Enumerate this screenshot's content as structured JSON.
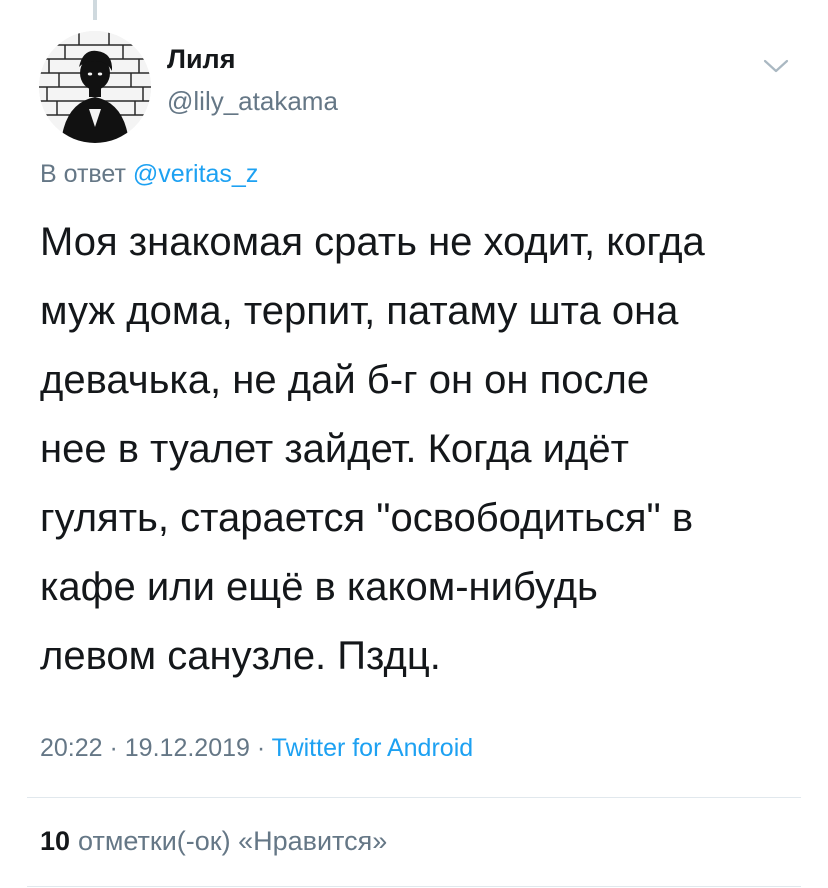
{
  "tweet": {
    "author": {
      "name": "Лиля",
      "handle": "@lily_atakama"
    },
    "reply": {
      "prefix": "В ответ",
      "mention": "@veritas_z"
    },
    "text": "Моя знакомая срать не ходит, когда\nмуж дома, терпит, патаму шта она\nдевачька, не дай б-г он он после\nнее в туалет зайдет. Когда идёт\nгулять, старается \"освободиться\" в\nкафе или ещё в каком-нибудь\nлевом санузле. Пздц.",
    "meta": {
      "time": "20:22",
      "separator": " · ",
      "date": "19.12.2019",
      "source": "Twitter for Android"
    },
    "likes": {
      "count": "10",
      "label": "отметки(-ок) «Нравится»"
    }
  },
  "icons": {
    "more": "chevron-down-icon",
    "avatar": "profile-photo"
  },
  "colors": {
    "text": "#14171a",
    "secondary": "#657786",
    "link": "#1da1f2",
    "divider": "#e1e8ed"
  }
}
